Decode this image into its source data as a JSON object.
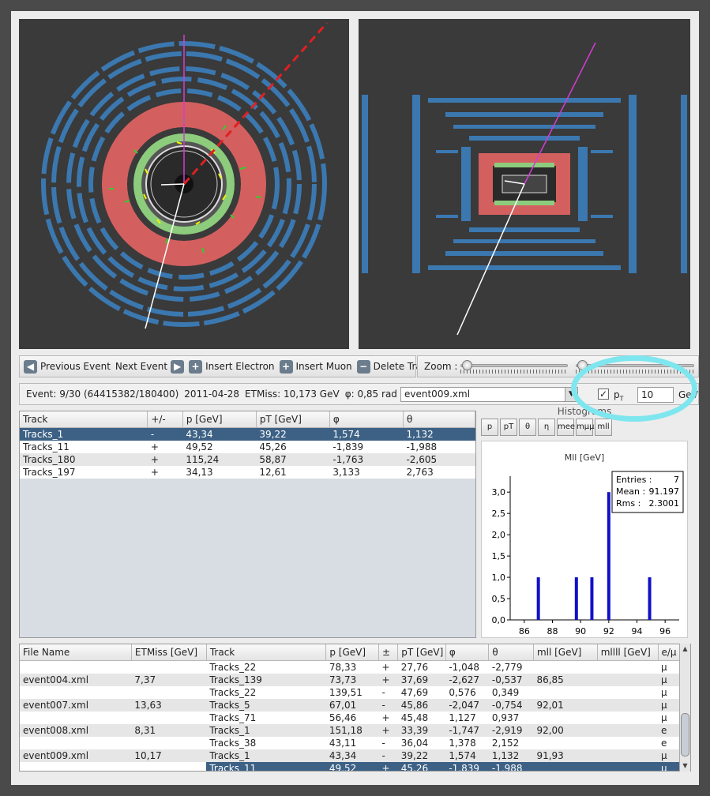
{
  "toolbar": {
    "prev_label": "Previous Event",
    "next_label": "Next Event",
    "electron_label": "Insert Electron",
    "muon_label": "Insert Muon",
    "delete_label": "Delete Track",
    "zoom_label": "Zoom :"
  },
  "info": {
    "event": "Event: 9/30 (64415382/180400)",
    "date": "2011-04-28",
    "etmiss": "ETMiss: 10,173 GeV",
    "phi": "φ: 0,85 rad",
    "file_selected": "event009.xml",
    "pt_label": "p",
    "pt_sub": "T",
    "pt_value": "10",
    "pt_unit": "GeV"
  },
  "track_table": {
    "headers": [
      "Track",
      "+/-",
      "p [GeV]",
      "pT [GeV]",
      "φ",
      "θ"
    ],
    "rows": [
      [
        "Tracks_1",
        "-",
        "43,34",
        "39,22",
        "1,574",
        "1,132"
      ],
      [
        "Tracks_11",
        "+",
        "49,52",
        "45,26",
        "-1,839",
        "-1,988"
      ],
      [
        "Tracks_180",
        "+",
        "115,24",
        "58,87",
        "-1,763",
        "-2,605"
      ],
      [
        "Tracks_197",
        "+",
        "34,13",
        "12,61",
        "3,133",
        "2,763"
      ]
    ]
  },
  "histograms": {
    "title": "Histograms",
    "tabs": [
      "p",
      "pT",
      "θ",
      "η",
      "mee",
      "mμμ",
      "mll"
    ],
    "plot_title": "Mll [GeV]",
    "stats": {
      "entries_label": "Entries :",
      "entries": "7",
      "mean_label": "Mean :",
      "mean": "91.197",
      "rms_label": "Rms :",
      "rms": "2.3001"
    }
  },
  "chart_data": {
    "type": "bar",
    "title": "Mll [GeV]",
    "x": [
      87.0,
      89.7,
      90.8,
      92.0,
      94.9
    ],
    "values": [
      1,
      1,
      1,
      3,
      1
    ],
    "xlim": [
      85,
      97
    ],
    "ylim": [
      0,
      3.3
    ],
    "xticks": [
      "86",
      "88",
      "90",
      "92",
      "94",
      "96"
    ],
    "yticks": [
      "0,0",
      "0,5",
      "1,0",
      "1,5",
      "2,0",
      "2,5",
      "3,0"
    ],
    "bar_color": "#1010c8"
  },
  "file_table": {
    "headers": [
      "File Name",
      "ETMiss [GeV]",
      "Track",
      "p [GeV]",
      "±",
      "pT [GeV]",
      "φ",
      "θ",
      "mll [GeV]",
      "mllll [GeV]",
      "e/μ"
    ],
    "rows": [
      [
        "",
        "",
        "Tracks_22",
        "78,33",
        "+",
        "27,76",
        "-1,048",
        "-2,779",
        "",
        "",
        "μ"
      ],
      [
        "event004.xml",
        "7,37",
        "Tracks_139",
        "73,73",
        "+",
        "37,69",
        "-2,627",
        "-0,537",
        "86,85",
        "",
        "μ"
      ],
      [
        "",
        "",
        "Tracks_22",
        "139,51",
        "-",
        "47,69",
        "0,576",
        "0,349",
        "",
        "",
        "μ"
      ],
      [
        "event007.xml",
        "13,63",
        "Tracks_5",
        "67,01",
        "-",
        "45,86",
        "-2,047",
        "-0,754",
        "92,01",
        "",
        "μ"
      ],
      [
        "",
        "",
        "Tracks_71",
        "56,46",
        "+",
        "45,48",
        "1,127",
        "0,937",
        "",
        "",
        "μ"
      ],
      [
        "event008.xml",
        "8,31",
        "Tracks_1",
        "151,18",
        "+",
        "33,39",
        "-1,747",
        "-2,919",
        "92,00",
        "",
        "e"
      ],
      [
        "",
        "",
        "Tracks_38",
        "43,11",
        "-",
        "36,04",
        "1,378",
        "2,152",
        "",
        "",
        "e"
      ],
      [
        "event009.xml",
        "10,17",
        "Tracks_1",
        "43,34",
        "-",
        "39,22",
        "1,574",
        "1,132",
        "91,93",
        "",
        "μ"
      ],
      [
        "",
        "",
        "Tracks_11",
        "49,52",
        "+",
        "45,26",
        "-1,839",
        "-1,988",
        "",
        "",
        "μ"
      ]
    ]
  },
  "colors": {
    "accent": "#3d6185",
    "highlight": "#7ee6ee",
    "detector_blue": "#3b78b0",
    "calo_red": "#d35f5f",
    "tracker_green": "#8ccc7c"
  }
}
